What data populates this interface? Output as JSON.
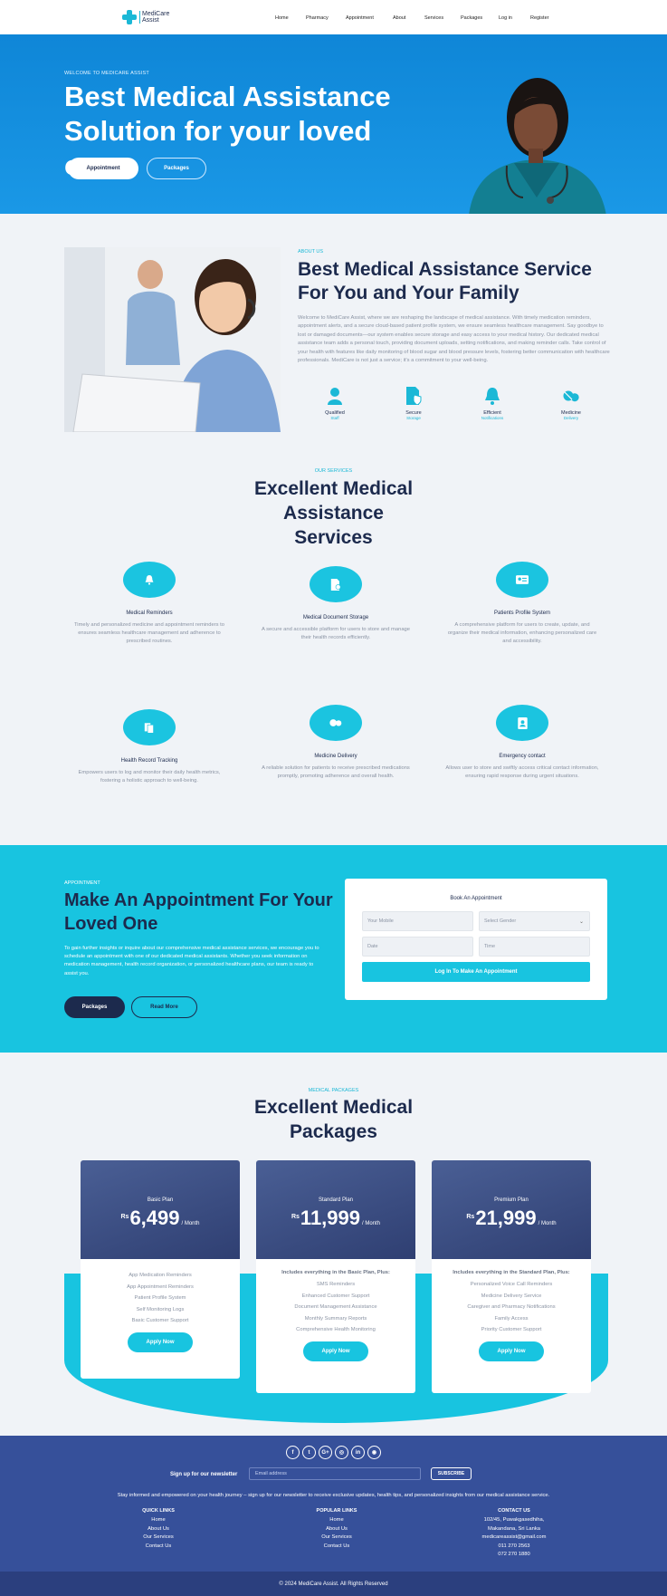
{
  "brand": {
    "line1": "MediCare",
    "line2": "Assist",
    "accent": "#1bb8d6",
    "navy": "#1c2a4d"
  },
  "nav": {
    "items": [
      "Home",
      "Pharmacy",
      "Appointment",
      "About",
      "Services",
      "Packages",
      "Log in",
      "Register"
    ]
  },
  "hero": {
    "eyebrow": "WELCOME TO MEDICARE ASSIST",
    "title": "Best Medical Assistance Solution for your loved ones",
    "btn_primary": "Appointment",
    "btn_secondary": "Packages"
  },
  "about": {
    "eyebrow": "ABOUT US",
    "title": "Best Medical Assistance Service For You and Your Family",
    "text": "Welcome to MediCare Assist, where we are reshaping the landscape of medical assistance. With timely medication reminders, appointment alerts, and a secure cloud-based patient profile system, we ensure seamless healthcare management. Say goodbye to lost or damaged documents—our system enables secure storage and easy access to your medical history. Our dedicated medical assistance team adds a personal touch, providing document uploads, setting notifications, and making reminder calls. Take control of your health with features like daily monitoring of blood sugar and blood pressure levels, fostering better communication with healthcare professionals. MediCare is not just a service; it's a commitment to your well-being.",
    "features": [
      {
        "label": "Qualified",
        "sub": "Staff",
        "icon": "user-icon"
      },
      {
        "label": "Secure",
        "sub": "Storage",
        "icon": "secure-document-icon"
      },
      {
        "label": "Efficient",
        "sub": "Notifications",
        "icon": "bell-icon"
      },
      {
        "label": "Medicine",
        "sub": "Delivery",
        "icon": "pills-icon"
      }
    ]
  },
  "services": {
    "eyebrow": "OUR SERVICES",
    "title": "Excellent Medical Assistance Services",
    "items": [
      {
        "title": "Medical Reminders",
        "desc": "Timely and personalized medicine and appointment reminders to ensures seamless healthcare management and adherence to prescribed routines.",
        "icon": "bell-icon"
      },
      {
        "title": "Medical Document Storage",
        "desc": "A secure and accessible platform for users to store and manage their health records efficiently.",
        "icon": "document-icon"
      },
      {
        "title": "Patients Profile System",
        "desc": "A comprehensive platform for users to create, update, and organize their medical information, enhancing personalized care and accessibility.",
        "icon": "id-card-icon"
      },
      {
        "title": "Health Record Tracking",
        "desc": "Empowers users to log and monitor their daily health metrics, fostering a holistic approach to well-being.",
        "icon": "files-icon"
      },
      {
        "title": "Medicine Delivery",
        "desc": "A reliable solution for patients to receive prescribed medications promptly, promoting adherence and overall health.",
        "icon": "pills-icon"
      },
      {
        "title": "Emergency contact",
        "desc": "Allows user to store and swiftly access critical contact information, ensuring rapid response during urgent situations.",
        "icon": "contact-book-icon"
      }
    ]
  },
  "appointment": {
    "eyebrow": "APPOINTMENT",
    "title": "Make An Appointment For Your Loved One",
    "text": "To gain further insights or inquire about our comprehensive medical assistance services, we encourage you to schedule an appointment with one of our dedicated medical assistants. Whether you seek information on medication management, health record organization, or personalized healthcare plans, our team is ready to assist you.",
    "btn_primary": "Packages",
    "btn_secondary": "Read More",
    "form": {
      "title": "Book An Appointment",
      "mobile_placeholder": "Your Mobile",
      "gender_placeholder": "Select Gender",
      "date_placeholder": "Date",
      "time_placeholder": "Time",
      "submit": "Log In To Make An Appointment"
    }
  },
  "packages": {
    "eyebrow": "MEDICAL PACKAGES",
    "title": "Excellent Medical Packages",
    "items": [
      {
        "name": "Basic Plan",
        "currency": "Rs",
        "price": "6,499",
        "per": "/ Month",
        "includes": "",
        "features": [
          "App Medication Reminders",
          "App Appointment Reminders",
          "Patient Profile System",
          "Self Monitoring Logs",
          "Basic Customer Support"
        ],
        "button": "Apply Now"
      },
      {
        "name": "Standard Plan",
        "currency": "Rs",
        "price": "11,999",
        "per": "/ Month",
        "includes": "Includes everything in the Basic Plan, Plus:",
        "features": [
          "SMS Reminders",
          "Enhanced Customer Support",
          "Document Management Assistance",
          "Monthly Summary Reports",
          "Comprehensive Health Monitoring"
        ],
        "button": "Apply Now"
      },
      {
        "name": "Premium Plan",
        "currency": "Rs",
        "price": "21,999",
        "per": "/ Month",
        "includes": "Includes everything in the Standard Plan, Plus:",
        "features": [
          "Personalized Voice Call Reminders",
          "Medicine Delivery Service",
          "Caregiver and Pharmacy Notifications",
          "Family Access",
          "Priority Customer Support"
        ],
        "button": "Apply Now"
      }
    ]
  },
  "footer": {
    "socials": [
      "facebook-icon",
      "twitter-icon",
      "google-plus-icon",
      "instagram-icon",
      "linkedin-icon",
      "github-icon"
    ],
    "social_glyphs": [
      "f",
      "t",
      "G+",
      "◎",
      "in",
      "◉"
    ],
    "newsletter_label": "Sign up for our newsletter",
    "email_placeholder": "Email address",
    "subscribe": "SUBSCRIBE",
    "newsletter_text": "Stay informed and empowered on your health journey – sign up for our newsletter to receive exclusive updates, health tips, and personalized insights from our medical assistance service.",
    "quick_links": {
      "heading": "QUICK LINKS",
      "items": [
        "Home",
        "About Us",
        "Our Services",
        "Contact Us"
      ]
    },
    "popular_links": {
      "heading": "POPULAR LINKS",
      "items": [
        "Home",
        "About Us",
        "Our Services",
        "Contact Us"
      ]
    },
    "contact": {
      "heading": "CONTACT US",
      "items": [
        "102/45, Puwakgasedhiha,",
        "Makandana, Sri Lanka",
        "medicareassist@gmail.com",
        "011 270 2563",
        "072 270 1880"
      ]
    },
    "copyright": "© 2024 MediCare Assist. All Rights Reserved"
  }
}
